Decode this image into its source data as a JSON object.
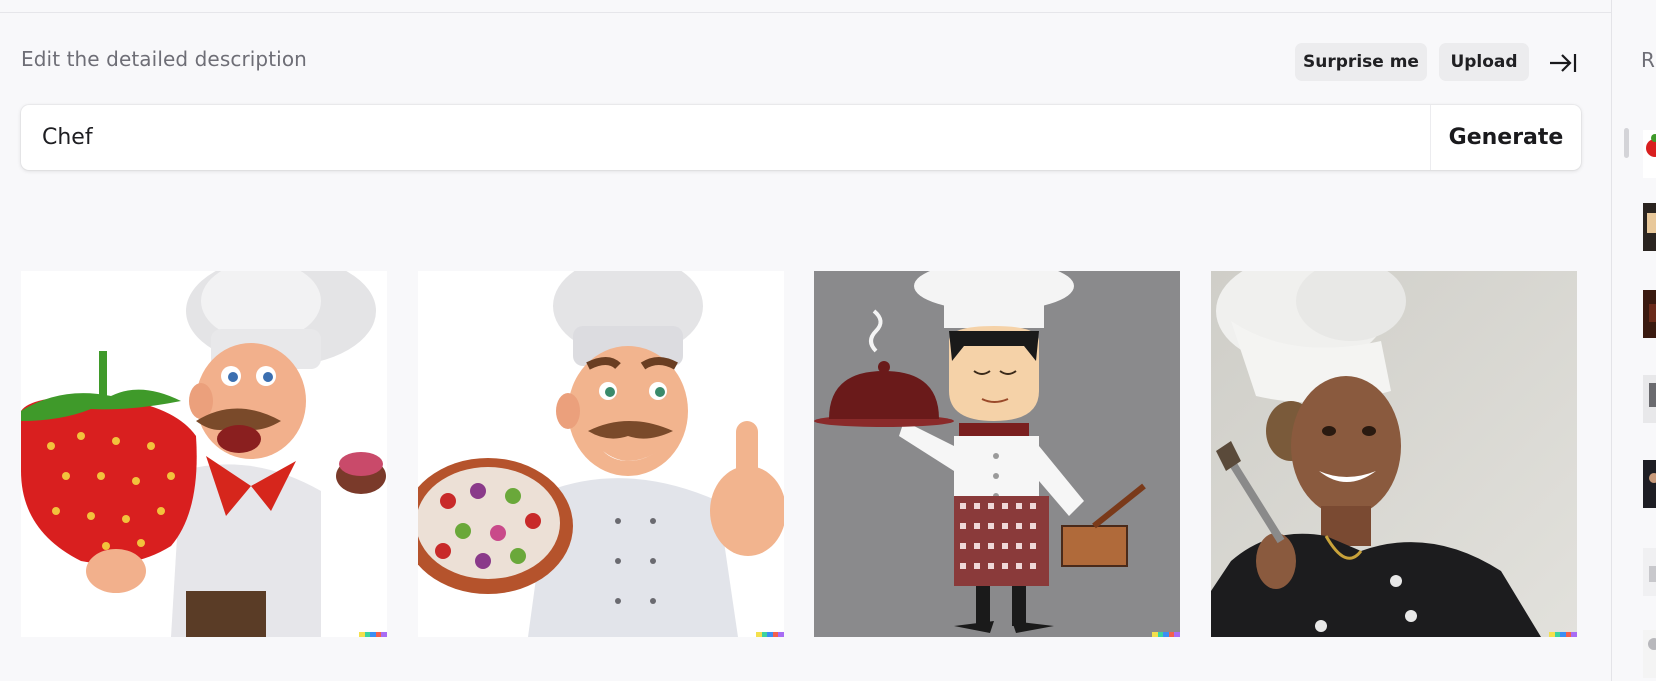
{
  "header": {
    "title": "Edit the detailed description",
    "surprise_label": "Surprise me",
    "upload_label": "Upload"
  },
  "prompt": {
    "value": "Chef",
    "generate_label": "Generate"
  },
  "results": [
    {
      "name": "result-image-1",
      "subject": "cartoon chef holding strawberry"
    },
    {
      "name": "result-image-2",
      "subject": "cartoon chef holding pizza with thumbs up"
    },
    {
      "name": "result-image-3",
      "subject": "flat illustration chef carrying cloche"
    },
    {
      "name": "result-image-4",
      "subject": "photo of smiling chef in black jacket"
    }
  ],
  "sidebar": {
    "title_partial": "R"
  },
  "colors": {
    "background": "#f8f8fa",
    "signature": [
      "#f4e04d",
      "#3cd3a0",
      "#3c8ef4",
      "#f4604d",
      "#a86cf4"
    ]
  }
}
